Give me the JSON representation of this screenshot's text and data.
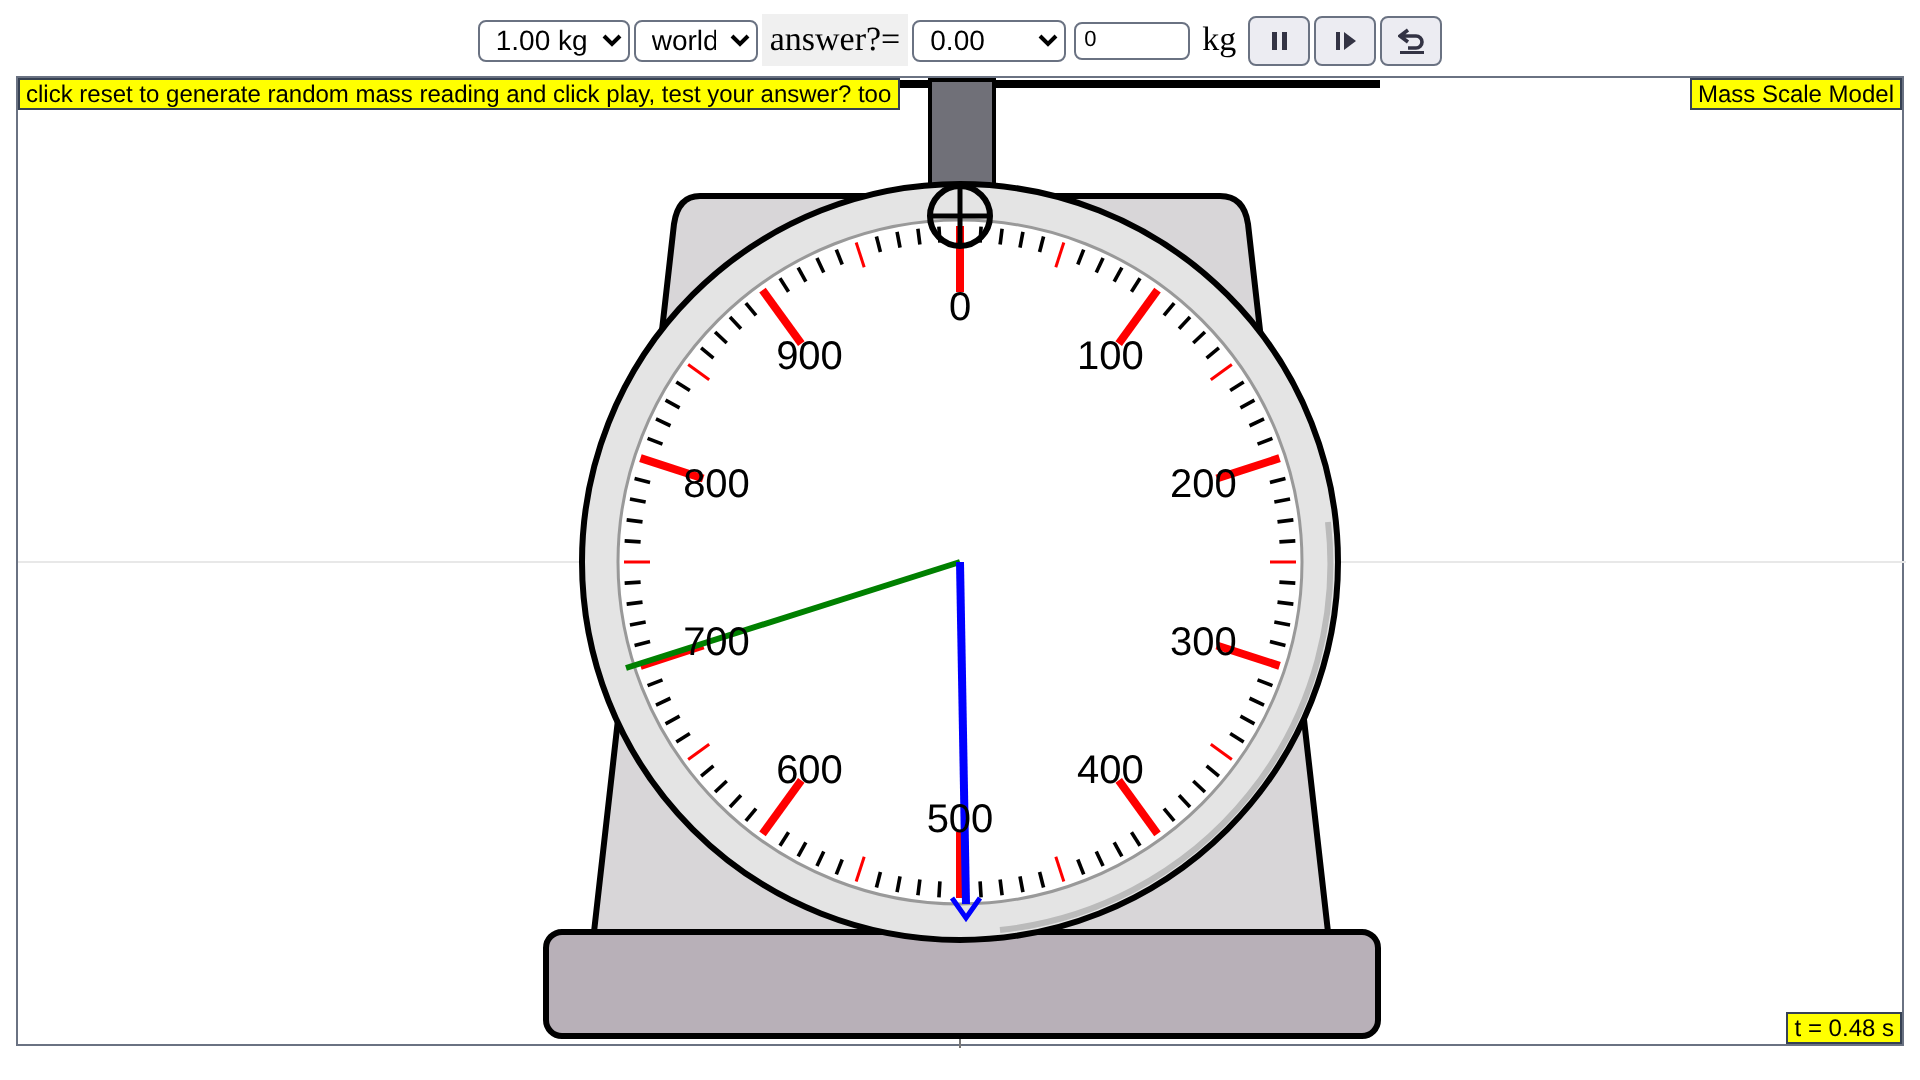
{
  "toolbar": {
    "mass_select": "1.00 kg",
    "location_select": "world",
    "answer_label": "answer?=",
    "answer_select": "0.00",
    "answer_input": "0",
    "unit": "kg",
    "buttons": [
      {
        "kind": "pause"
      },
      {
        "kind": "step"
      },
      {
        "kind": "reset"
      }
    ]
  },
  "hint": "click reset to generate random mass reading and click play, test your answer? too",
  "title": "Mass Scale Model",
  "dial_labels": [
    "0",
    "100",
    "200",
    "300",
    "400",
    "500",
    "600",
    "700",
    "800",
    "900"
  ],
  "time": "t = 0.48 s"
}
